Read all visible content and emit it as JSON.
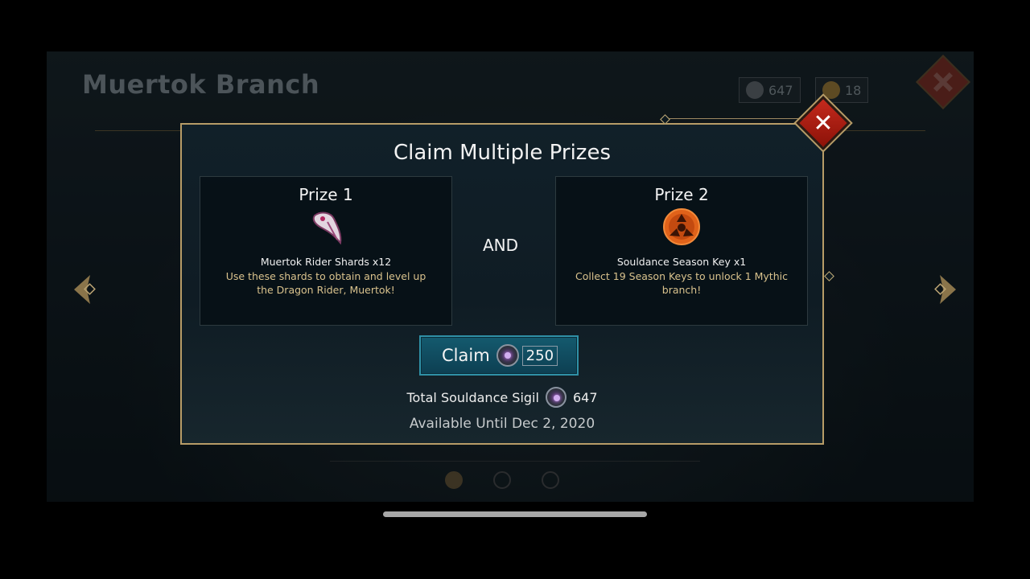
{
  "background": {
    "title": "Muertok Branch",
    "currencies": [
      {
        "icon": "souldance-sigil-icon",
        "value": "647"
      },
      {
        "icon": "gold-key-icon",
        "value": "18"
      }
    ]
  },
  "modal": {
    "title": "Claim Multiple Prizes",
    "prizes": [
      {
        "heading": "Prize 1",
        "icon": "bone-shard-icon",
        "name": "Muertok Rider Shards x12",
        "description": "Use these shards to obtain and level up the Dragon Rider, Muertok!"
      },
      {
        "heading": "Prize 2",
        "icon": "season-key-icon",
        "name": "Souldance Season Key x1",
        "description": "Collect 19 Season Keys to unlock 1 Mythic branch!"
      }
    ],
    "connector": "AND",
    "claim": {
      "label": "Claim",
      "cost": "250"
    },
    "total": {
      "label": "Total Souldance Sigil",
      "value": "647"
    },
    "available": "Available Until Dec 2, 2020"
  },
  "pagination": {
    "pages": 3,
    "active_index": 0
  },
  "colors": {
    "frame_gold": "#b79c67",
    "claim_button": "#145a6e",
    "close_red": "#c42a1d",
    "description_text": "#d9c28d"
  }
}
